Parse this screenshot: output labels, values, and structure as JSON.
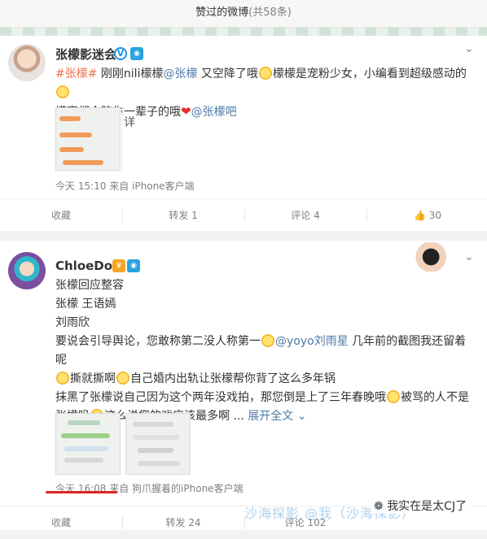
{
  "header": {
    "title": "赞过的微博",
    "count": "(共58条)"
  },
  "post1": {
    "author": "张檬影迷会",
    "text_line1_a": "#张檬#",
    "text_line1_b": " 刚刚nili檬檬",
    "text_line1_c": "@张檬",
    "text_line1_d": " 又空降了哦",
    "text_line1_e": "檬檬是宠粉少女，小编看到超级感动的",
    "text_line2_a": "檬蜜们会陪你一辈子的哦",
    "text_line2_b": "@张檬吧",
    "thumb_side_char": "详",
    "time": "今天 15:10",
    "source": "来自 iPhone客户端",
    "actions": {
      "favorite": "收藏",
      "repost": "转发 1",
      "comment": "评论 4",
      "like": "30"
    }
  },
  "post2": {
    "author": "ChloeDog",
    "lines": [
      "张檬回应整容",
      "张檬 王语嫣",
      "刘雨欣",
      "要说会引导舆论，您敢称第二没人称第一"
    ],
    "mention": "@yoyo刘雨星",
    "line4_tail": " 几年前的截图我还留着呢",
    "line5_a": "撕就撕啊",
    "line5_b": "自己婚内出轨让张檬帮你背了这么多年锅",
    "line6_a": "抹黑了张檬说自己因为这个两年没戏拍，那您倒是上了三年春晚哦",
    "line6_b": "被骂的人不是",
    "line7_a": "张檬吗",
    "line7_b": "这么说您的戏应该最多啊 ...",
    "expand": "展开全文",
    "time": "今天 16:08",
    "source": "来自 狗爪握着的iPhone客户端",
    "actions": {
      "favorite": "收藏",
      "repost": "转发 24",
      "comment": "评论 102"
    }
  },
  "watermark": {
    "main": "沙海探影 @我（沙海探影）",
    "logo": "我实在是太CJ了"
  },
  "colors": {
    "link": "#eb7350",
    "mention": "#4e7ba8",
    "underline": "#e0241f"
  }
}
